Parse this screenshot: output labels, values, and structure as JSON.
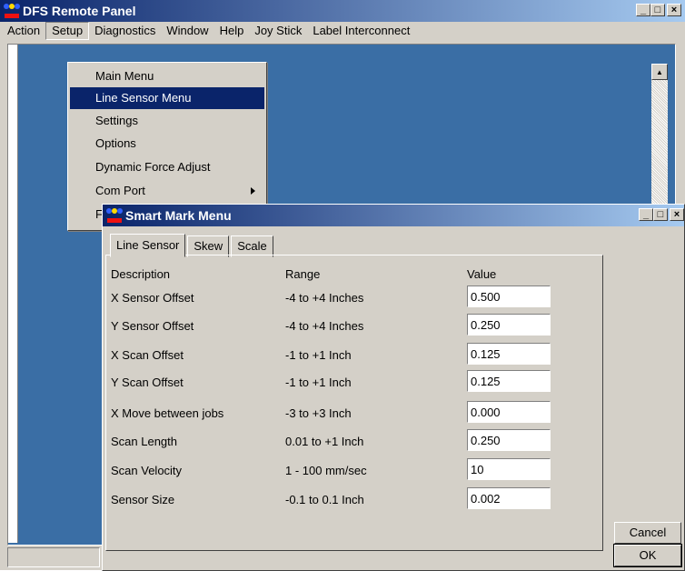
{
  "main_window": {
    "title": "DFS Remote Panel",
    "menu": [
      "Action",
      "Setup",
      "Diagnostics",
      "Window",
      "Help",
      "Joy Stick",
      "Label Interconnect"
    ]
  },
  "setup_menu": {
    "items": [
      "Main Menu",
      "Line Sensor Menu",
      "Settings",
      "Options",
      "Dynamic Force Adjust",
      "Com Port",
      "F"
    ],
    "highlighted": "Line Sensor Menu"
  },
  "dialog": {
    "title": "Smart Mark Menu",
    "tabs": [
      "Line Sensor",
      "Skew",
      "Scale"
    ],
    "active_tab": "Line Sensor",
    "headers": {
      "description": "Description",
      "range": "Range",
      "value": "Value"
    },
    "rows": [
      {
        "description": "X Sensor Offset",
        "range": "-4 to +4 Inches",
        "value": "0.500"
      },
      {
        "description": "Y Sensor Offset",
        "range": "-4 to +4 Inches",
        "value": "0.250"
      },
      {
        "description": "X Scan Offset",
        "range": "-1 to +1 Inch",
        "value": "0.125"
      },
      {
        "description": "Y Scan Offset",
        "range": "-1 to +1 Inch",
        "value": "0.125"
      },
      {
        "description": "X Move between jobs",
        "range": "-3 to +3 Inch",
        "value": "0.000"
      },
      {
        "description": "Scan Length",
        "range": "0.01 to +1 Inch",
        "value": "0.250"
      },
      {
        "description": "Scan Velocity",
        "range": "1 - 100 mm/sec",
        "value": "10"
      },
      {
        "description": "Sensor Size",
        "range": "-0.1 to 0.1 Inch",
        "value": "0.002"
      }
    ],
    "buttons": {
      "cancel": "Cancel",
      "ok": "OK"
    }
  },
  "caption_buttons": {
    "minimize": "_",
    "maximize": "□",
    "close": "×"
  },
  "colors": {
    "titlebar_start": "#0a246a",
    "titlebar_end": "#a6caf0",
    "workspace": "#3a6ea5",
    "face": "#d4d0c8"
  }
}
